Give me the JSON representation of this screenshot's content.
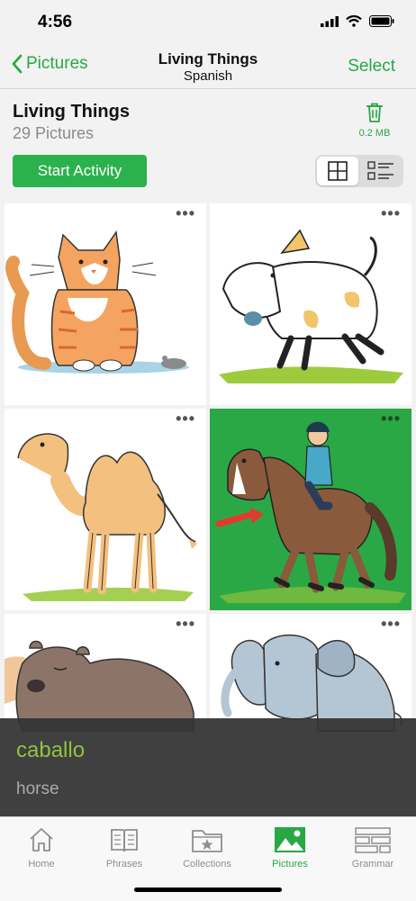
{
  "status_bar": {
    "time": "4:56"
  },
  "nav": {
    "back_label": "Pictures",
    "title": "Living Things",
    "subtitle": "Spanish",
    "select_label": "Select"
  },
  "collection": {
    "title": "Living Things",
    "count_label": "29 Pictures",
    "storage_size": "0.2 MB",
    "start_label": "Start Activity",
    "view_mode": "grid"
  },
  "pictures": [
    {
      "subject": "cat",
      "selected": false,
      "more": "•••"
    },
    {
      "subject": "dog",
      "selected": false,
      "more": "•••"
    },
    {
      "subject": "camel",
      "selected": false,
      "more": "•••"
    },
    {
      "subject": "horse",
      "selected": true,
      "more": "•••"
    },
    {
      "subject": "bear",
      "selected": false,
      "more": "•••"
    },
    {
      "subject": "elephant",
      "selected": false,
      "more": "•••"
    }
  ],
  "overlay": {
    "word": "caballo",
    "translation": "horse"
  },
  "tabs": [
    {
      "label": "Home",
      "icon": "home-icon",
      "active": false
    },
    {
      "label": "Phrases",
      "icon": "book-icon",
      "active": false
    },
    {
      "label": "Collections",
      "icon": "folder-star-icon",
      "active": false
    },
    {
      "label": "Pictures",
      "icon": "image-icon",
      "active": true
    },
    {
      "label": "Grammar",
      "icon": "grammar-icon",
      "active": false
    }
  ],
  "colors": {
    "accent": "#27a844",
    "button": "#2bb24c",
    "overlay_word": "#8fc43f",
    "selected_tile": "#2aa845"
  }
}
